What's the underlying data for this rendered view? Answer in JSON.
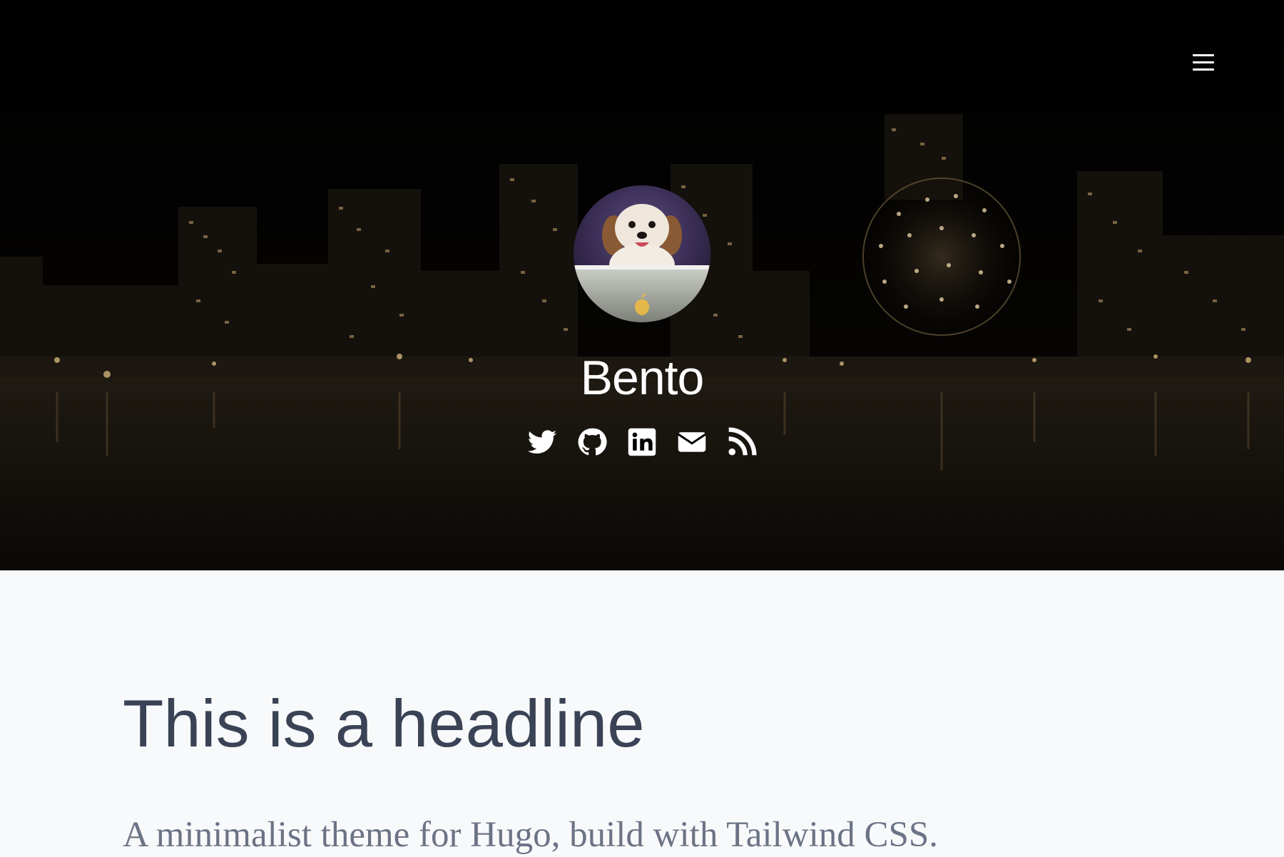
{
  "header": {
    "site_title": "Bento",
    "menu_icon": "hamburger-menu-icon",
    "avatar_alt": "dog-avatar",
    "social_links": [
      {
        "name": "twitter",
        "icon": "twitter-icon"
      },
      {
        "name": "github",
        "icon": "github-icon"
      },
      {
        "name": "linkedin",
        "icon": "linkedin-icon"
      },
      {
        "name": "email",
        "icon": "envelope-icon"
      },
      {
        "name": "rss",
        "icon": "rss-icon"
      }
    ]
  },
  "main": {
    "headline": "This is a headline",
    "tagline": "A minimalist theme for Hugo, build with Tailwind CSS."
  },
  "colors": {
    "hero_background": "#000000",
    "page_background": "#f8f9fb",
    "headline": "#3a4355",
    "tagline": "#6b7385",
    "icons": "#ffffff"
  }
}
